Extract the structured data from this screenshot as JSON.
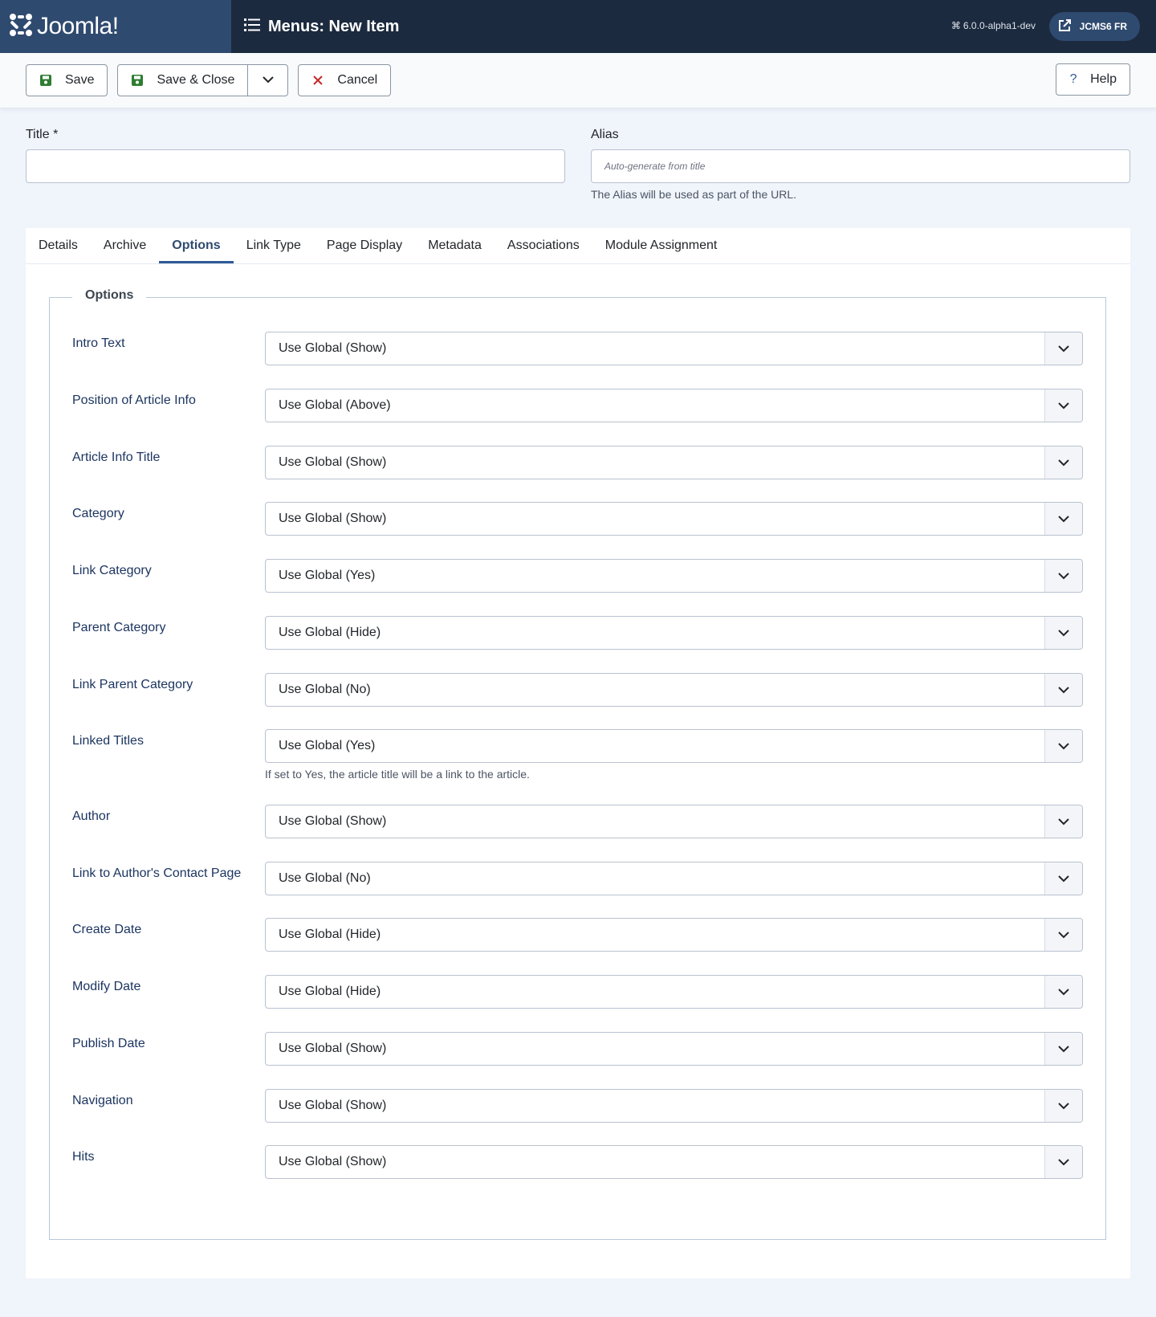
{
  "header": {
    "brand": "Joomla!",
    "title": "Menus: New Item",
    "version": "6.0.0-alpha1-dev",
    "site_button": "JCMS6 FR"
  },
  "toolbar": {
    "save": "Save",
    "save_close": "Save & Close",
    "cancel": "Cancel",
    "help": "Help"
  },
  "form": {
    "title_label": "Title *",
    "title_value": "",
    "alias_label": "Alias",
    "alias_placeholder": "Auto-generate from title",
    "alias_help": "The Alias will be used as part of the URL."
  },
  "tabs": [
    "Details",
    "Archive",
    "Options",
    "Link Type",
    "Page Display",
    "Metadata",
    "Associations",
    "Module Assignment"
  ],
  "active_tab": "Options",
  "options": {
    "legend": "Options",
    "rows": [
      {
        "label": "Intro Text",
        "value": "Use Global (Show)"
      },
      {
        "label": "Position of Article Info",
        "value": "Use Global (Above)"
      },
      {
        "label": "Article Info Title",
        "value": "Use Global (Show)"
      },
      {
        "label": "Category",
        "value": "Use Global (Show)"
      },
      {
        "label": "Link Category",
        "value": "Use Global (Yes)"
      },
      {
        "label": "Parent Category",
        "value": "Use Global (Hide)"
      },
      {
        "label": "Link Parent Category",
        "value": "Use Global (No)"
      },
      {
        "label": "Linked Titles",
        "value": "Use Global (Yes)",
        "help": "If set to Yes, the article title will be a link to the article."
      },
      {
        "label": "Author",
        "value": "Use Global (Show)"
      },
      {
        "label": "Link to Author's Contact Page",
        "value": "Use Global (No)"
      },
      {
        "label": "Create Date",
        "value": "Use Global (Hide)"
      },
      {
        "label": "Modify Date",
        "value": "Use Global (Hide)"
      },
      {
        "label": "Publish Date",
        "value": "Use Global (Show)"
      },
      {
        "label": "Navigation",
        "value": "Use Global (Show)"
      },
      {
        "label": "Hits",
        "value": "Use Global (Show)"
      }
    ]
  },
  "colors": {
    "header_bg": "#1c2a3f",
    "brand_bg": "#2f4a6f",
    "accent": "#2f5a96",
    "save_icon": "#2e7d32",
    "cancel_icon": "#c62828"
  }
}
